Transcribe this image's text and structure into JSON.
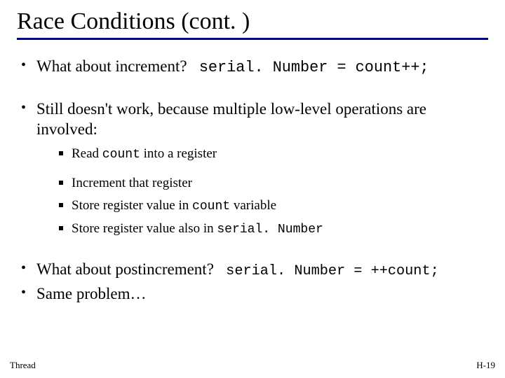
{
  "title": "Race Conditions (cont. )",
  "bullets": {
    "b1_text": "What about increment?",
    "b1_code": "serial. Number = count++;",
    "b2_intro": "Still doesn't work, because multiple low-level operations are involved:",
    "b2_sub1_pre": "Read ",
    "b2_sub1_code": "count",
    "b2_sub1_post": " into a register",
    "b2_sub2": "Increment that register",
    "b2_sub3_pre": "Store register value in ",
    "b2_sub3_code": "count",
    "b2_sub3_post": " variable",
    "b2_sub4_pre": "Store register value also in ",
    "b2_sub4_code": "serial. Number",
    "b3_text": "What about postincrement?",
    "b3_code": "serial. Number = ++count;",
    "b4": "Same problem…"
  },
  "footer": {
    "left": "Thread",
    "right": "H-19"
  }
}
